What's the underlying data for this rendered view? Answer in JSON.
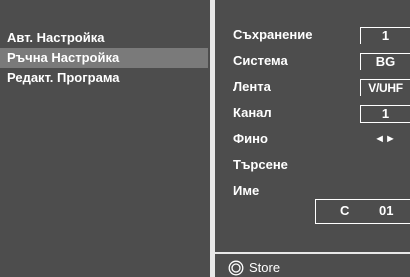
{
  "left_menu": {
    "items": [
      {
        "label": "Авт. Настройка",
        "selected": false
      },
      {
        "label": "Ръчна Настройка",
        "selected": true
      },
      {
        "label": "Редакт. Програма",
        "selected": false
      }
    ]
  },
  "settings": {
    "storage": {
      "label": "Съхранение",
      "value": "1"
    },
    "system": {
      "label": "Система",
      "value": "BG"
    },
    "band": {
      "label": "Лента",
      "value": "V/UHF"
    },
    "channel": {
      "label": "Канал",
      "value": "1"
    },
    "fine": {
      "label": "Фино",
      "value": "◄►"
    },
    "search": {
      "label": "Търсене"
    },
    "name": {
      "label": "Име",
      "prefix": "C",
      "number": "01"
    }
  },
  "footer": {
    "store_label": "Store",
    "store_icon": "store-button-icon"
  },
  "colors": {
    "background": "#4d4d4d",
    "highlight": "#7a7a7a",
    "divider": "#e8e8e8",
    "text": "#ffffff"
  }
}
